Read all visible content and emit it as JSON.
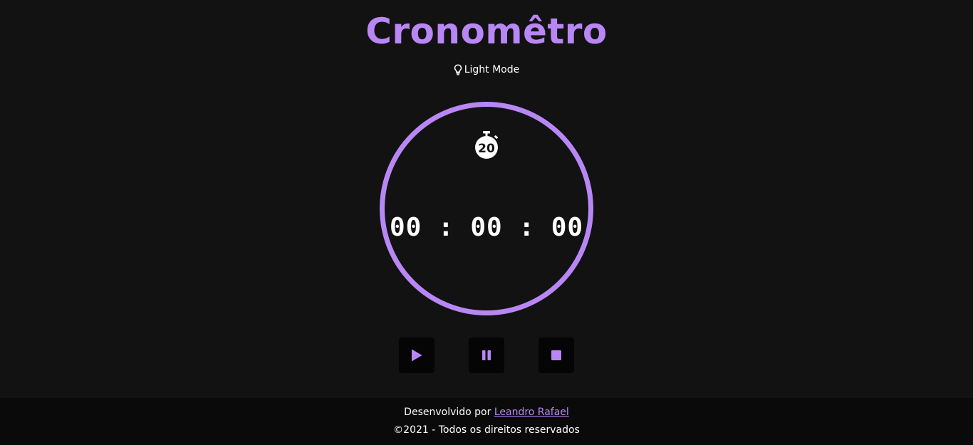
{
  "header": {
    "title": "Cronomêtro",
    "theme_toggle_label": "Light Mode",
    "theme_toggle_icon": "lightbulb-icon"
  },
  "timer": {
    "icon": "stopwatch-20-icon",
    "icon_text": "20",
    "display": "00 : 00 : 00"
  },
  "controls": {
    "play_icon": "play-icon",
    "pause_icon": "pause-icon",
    "stop_icon": "stop-icon"
  },
  "footer": {
    "developed_by": "Desenvolvido por",
    "author": "Leandro Rafael",
    "copyright": "©2021 - Todos os direitos reservados"
  },
  "colors": {
    "accent": "#b987f5",
    "background": "#121212",
    "footer_background": "#0a0a0a",
    "button_background": "#050505",
    "text": "#ffffff"
  }
}
